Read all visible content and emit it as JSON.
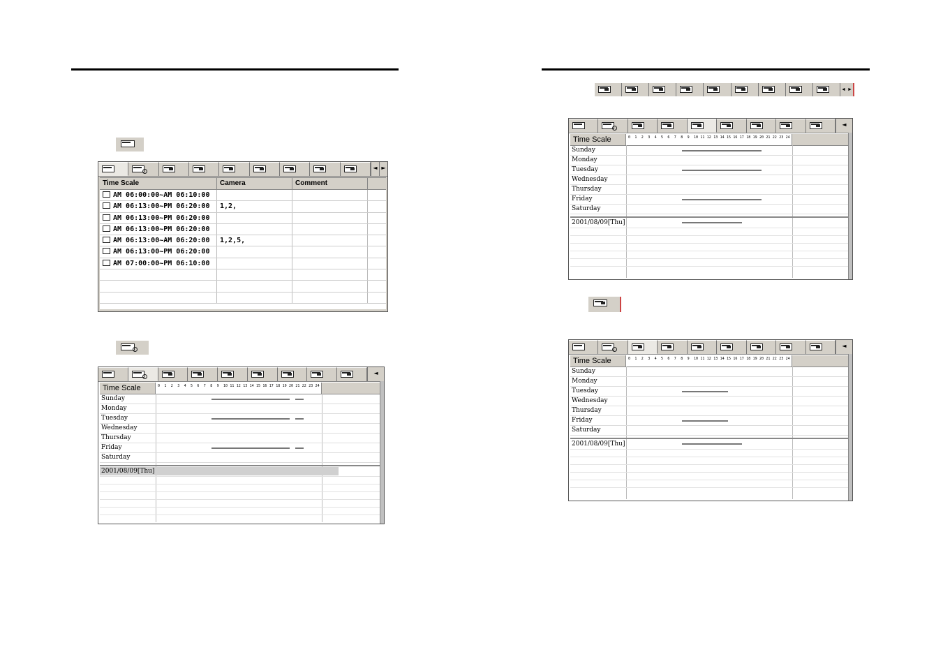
{
  "camera_toolbar": {
    "buttons": [
      "camera-1-icon",
      "camera-2-icon",
      "camera-3-icon",
      "camera-4-icon",
      "camera-5-icon",
      "camera-6-icon",
      "camera-7-icon",
      "camera-8-icon",
      "camera-9-icon"
    ],
    "arrows": [
      "◄",
      "►"
    ]
  },
  "list_panel": {
    "columns": [
      "Time Scale",
      "Camera",
      "Comment"
    ],
    "rows": [
      {
        "time": "AM 06:00:00~AM 06:10:00",
        "camera": "",
        "comment": ""
      },
      {
        "time": "AM 06:13:00~PM 06:20:00",
        "camera": "1,2,",
        "comment": ""
      },
      {
        "time": "AM 06:13:00~PM 06:20:00",
        "camera": "",
        "comment": ""
      },
      {
        "time": "AM 06:13:00~PM 06:20:00",
        "camera": "",
        "comment": ""
      },
      {
        "time": "AM 06:13:00~AM 06:20:00",
        "camera": "1,2,5,",
        "comment": ""
      },
      {
        "time": "AM 06:13:00~PM 06:20:00",
        "camera": "",
        "comment": ""
      },
      {
        "time": "AM 07:00:00~PM 06:10:00",
        "camera": "",
        "comment": ""
      }
    ]
  },
  "schedule": {
    "header": "Time Scale",
    "hours": [
      "0",
      "1",
      "2",
      "3",
      "4",
      "5",
      "6",
      "7",
      "8",
      "9",
      "10",
      "11",
      "12",
      "13",
      "14",
      "15",
      "16",
      "17",
      "18",
      "19",
      "20",
      "21",
      "22",
      "23",
      "24"
    ],
    "days": [
      "Sunday",
      "Monday",
      "Tuesday",
      "Wednesday",
      "Thursday",
      "Friday",
      "Saturday"
    ],
    "date": "2001/08/09[Thu]",
    "tab_arrow": "◄"
  }
}
